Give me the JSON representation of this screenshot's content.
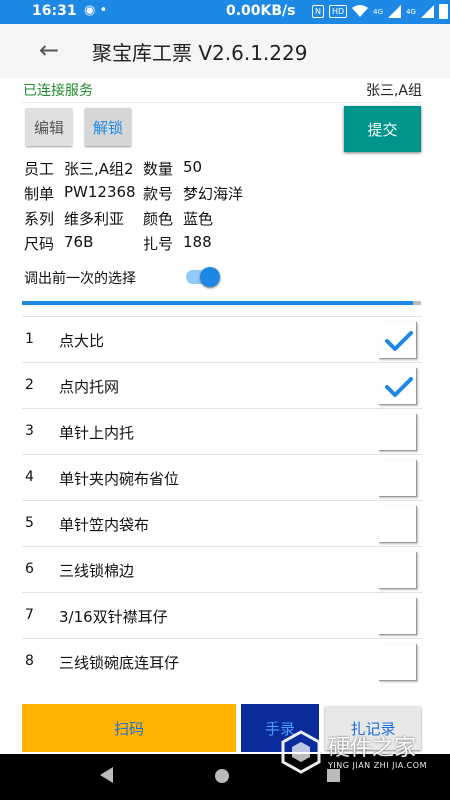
{
  "status_bar": {
    "time": "16:31",
    "notifications": "◉ •",
    "net_speed": "0.00KB/s",
    "nfc": "N",
    "hd": "HD",
    "signal1": "4G",
    "signal2": "4G"
  },
  "app_bar": {
    "title": "聚宝库工票 V2.6.1.229"
  },
  "connection": {
    "status": "已连接服务",
    "user": "张三,A组"
  },
  "actions": {
    "edit": "编辑",
    "unlock": "解锁",
    "submit": "提交"
  },
  "info": {
    "employee_label": "员工",
    "employee_value": "张三,A组2",
    "qty_label": "数量",
    "qty_value": "50",
    "order_label": "制单",
    "order_value": "PW12368",
    "style_label": "款号",
    "style_value": "梦幻海洋",
    "series_label": "系列",
    "series_value": "维多利亚",
    "color_label": "颜色",
    "color_value": "蓝色",
    "size_label": "尺码",
    "size_value": "76B",
    "bundle_label": "扎号",
    "bundle_value": "188"
  },
  "toggle": {
    "label": "调出前一次的选择",
    "on": true
  },
  "progress": {
    "fraction": 0.98
  },
  "operations": [
    {
      "num": "1",
      "name": "点大比",
      "checked": true
    },
    {
      "num": "2",
      "name": "点内托网",
      "checked": true
    },
    {
      "num": "3",
      "name": "单针上内托",
      "checked": false
    },
    {
      "num": "4",
      "name": "单针夹内碗布省位",
      "checked": false
    },
    {
      "num": "5",
      "name": "单针笠内袋布",
      "checked": false
    },
    {
      "num": "6",
      "name": "三线锁棉边",
      "checked": false
    },
    {
      "num": "7",
      "name": "3/16双针襟耳仔",
      "checked": false
    },
    {
      "num": "8",
      "name": "三线锁碗底连耳仔",
      "checked": false
    }
  ],
  "bottom": {
    "scan": "扫码",
    "manual": "手录",
    "records": "扎记录"
  },
  "watermark": {
    "text": "硬件之家",
    "sub": "YING JIAN ZHI JIA.COM"
  },
  "colors": {
    "primary": "#1e88e5",
    "submit": "#00958c",
    "scan": "#ffb300",
    "manual": "#0a2b9a"
  }
}
